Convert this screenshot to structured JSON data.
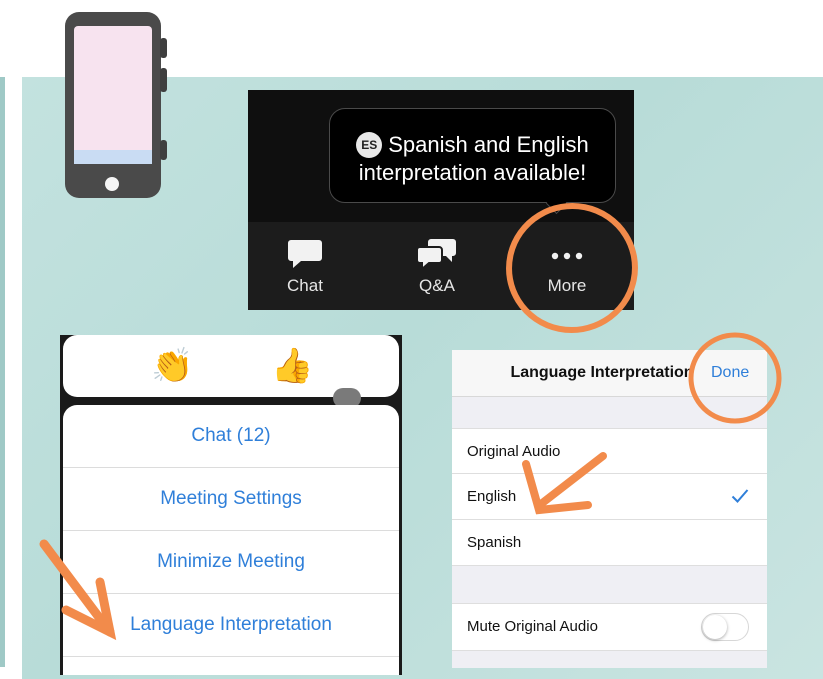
{
  "toolbar": {
    "tooltip_badge": "ES",
    "tooltip_line1": "Spanish and English",
    "tooltip_line2": "interpretation available!",
    "items": [
      {
        "label": "Chat",
        "icon": "chat-bubble-icon"
      },
      {
        "label": "Q&A",
        "icon": "qa-bubbles-icon"
      },
      {
        "label": "More",
        "icon": "more-dots-icon"
      }
    ]
  },
  "reactions": [
    {
      "emoji": "👏",
      "icon": "clapping-hands-icon"
    },
    {
      "emoji": "👍",
      "icon": "thumbs-up-icon"
    }
  ],
  "menu": {
    "items": [
      {
        "label": "Chat (12)"
      },
      {
        "label": "Meeting Settings"
      },
      {
        "label": "Minimize Meeting"
      },
      {
        "label": "Language Interpretation"
      }
    ]
  },
  "language_panel": {
    "title": "Language Interpretation",
    "done_label": "Done",
    "options": [
      {
        "label": "Original Audio",
        "selected": false
      },
      {
        "label": "English",
        "selected": true
      },
      {
        "label": "Spanish",
        "selected": false
      }
    ],
    "mute_label": "Mute Original Audio",
    "mute_on": false
  },
  "colors": {
    "accent_blue": "#2f7fd9",
    "annotation_orange": "#f28b4b",
    "background_teal": "#bfe0dc"
  }
}
